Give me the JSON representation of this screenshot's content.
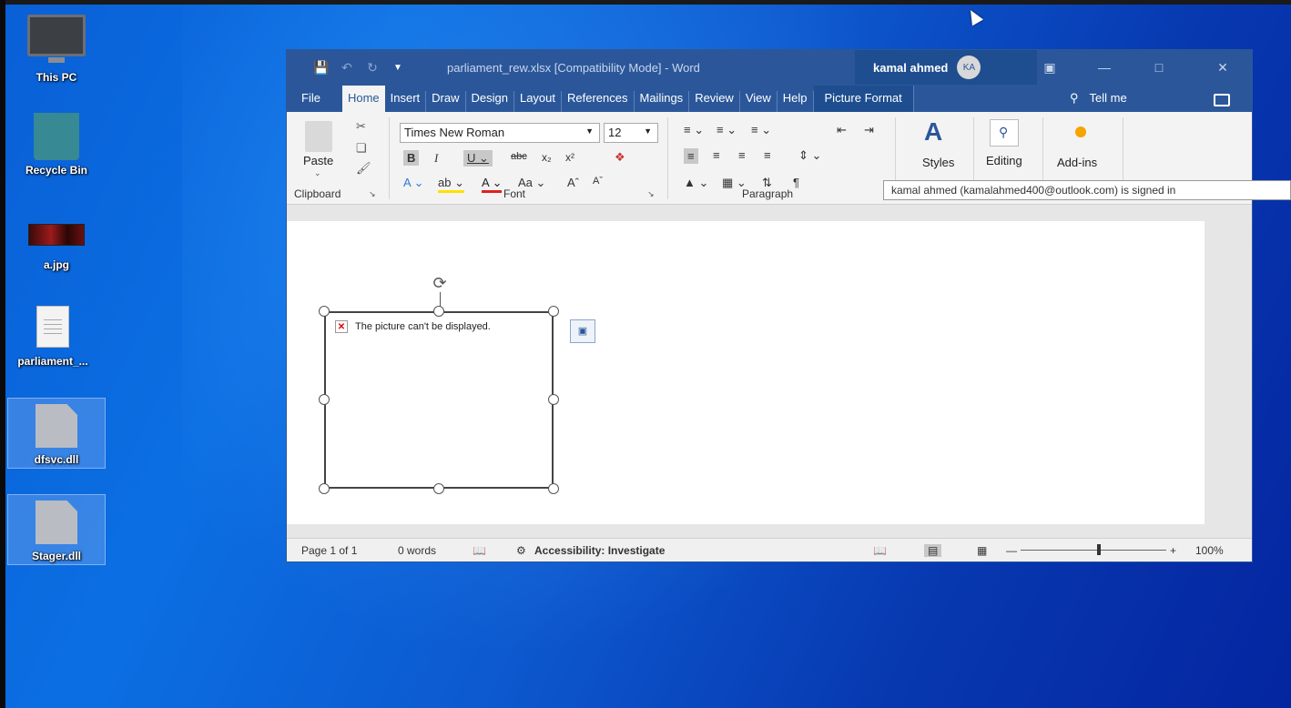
{
  "desktop": {
    "icons": [
      {
        "label": "This PC"
      },
      {
        "label": "Recycle Bin"
      },
      {
        "label": "a.jpg"
      },
      {
        "label": "parliament_..."
      },
      {
        "label": "dfsvc.dll"
      },
      {
        "label": "Stager.dll"
      }
    ]
  },
  "word": {
    "title": "parliament_rew.xlsx [Compatibility Mode] - Word",
    "user_name": "kamal ahmed",
    "user_initials": "KA",
    "tabs": [
      "File",
      "Home",
      "Insert",
      "Draw",
      "Design",
      "Layout",
      "References",
      "Mailings",
      "Review",
      "View",
      "Help",
      "Picture Format"
    ],
    "tell_me": "Tell me",
    "ribbon": {
      "paste_label": "Paste",
      "clipboard_label": "Clipboard",
      "font_name": "Times New Roman",
      "font_size": "12",
      "font_label": "Font",
      "paragraph_label": "Paragraph",
      "styles_label": "Styles",
      "editing_label": "Editing",
      "addins_label": "Add-ins"
    },
    "tooltip": "kamal ahmed (kamalahmed400@outlook.com) is signed in",
    "picture_error": "The picture can't be displayed.",
    "status": {
      "page": "Page 1 of 1",
      "words": "0 words",
      "accessibility": "Accessibility: Investigate",
      "zoom": "100%"
    }
  },
  "colors": {
    "word_blue": "#2b579a",
    "desktop_blue": "#0b6fe3"
  }
}
